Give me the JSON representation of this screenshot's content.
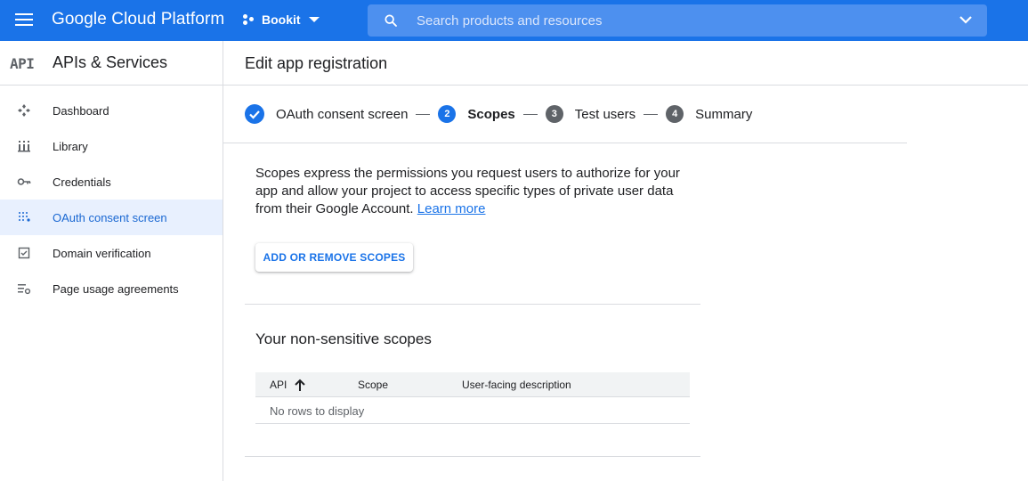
{
  "topbar": {
    "brand": "Google Cloud Platform",
    "project": "Bookit",
    "search_placeholder": "Search products and resources"
  },
  "sidebar": {
    "logo": "API",
    "title": "APIs & Services",
    "items": [
      {
        "label": "Dashboard",
        "icon": "dashboard-icon"
      },
      {
        "label": "Library",
        "icon": "library-icon"
      },
      {
        "label": "Credentials",
        "icon": "key-icon"
      },
      {
        "label": "OAuth consent screen",
        "icon": "consent-icon",
        "active": true
      },
      {
        "label": "Domain verification",
        "icon": "checkbox-icon"
      },
      {
        "label": "Page usage agreements",
        "icon": "settings-list-icon"
      }
    ]
  },
  "main": {
    "title": "Edit app registration",
    "steps": [
      {
        "label": "OAuth consent screen",
        "state": "done"
      },
      {
        "num": "2",
        "label": "Scopes",
        "state": "current"
      },
      {
        "num": "3",
        "label": "Test users",
        "state": "pending"
      },
      {
        "num": "4",
        "label": "Summary",
        "state": "pending"
      }
    ],
    "description": "Scopes express the permissions you request users to authorize for your app and allow your project to access specific types of private user data from their Google Account.",
    "learn_more": "Learn more",
    "add_scopes_button": "ADD OR REMOVE SCOPES",
    "section_title": "Your non-sensitive scopes",
    "table": {
      "columns": [
        "API",
        "Scope",
        "User-facing description"
      ],
      "empty_text": "No rows to display"
    }
  },
  "colors": {
    "accent": "#1a73e8",
    "active_bg": "#e8f0fe"
  }
}
